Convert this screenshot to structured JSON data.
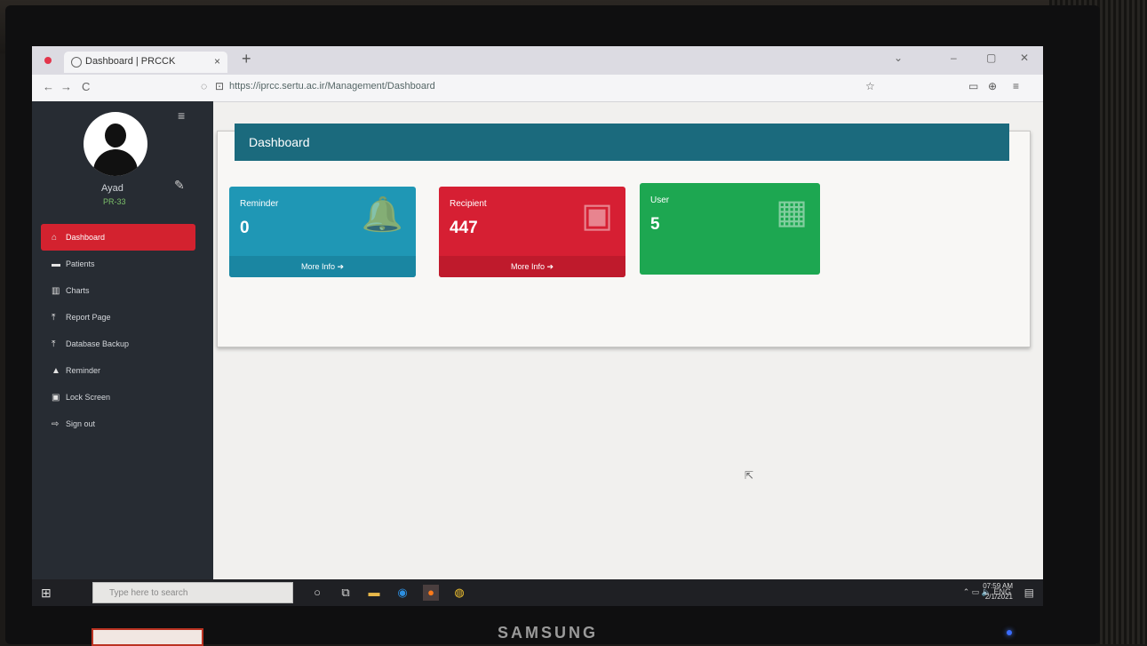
{
  "monitor": {
    "brand": "SAMSUNG"
  },
  "browser": {
    "tab_title": "Dashboard | PRCCK",
    "tab_close": "×",
    "new_tab": "+",
    "url": "https://iprcc.sertu.ac.ir/Management/Dashboard",
    "back": "←",
    "forward": "→",
    "reload": "C"
  },
  "sidebar": {
    "user_name": "Ayad",
    "user_status": "PR-33",
    "items": [
      {
        "label": "Dashboard",
        "icon": "home-icon",
        "glyph": "⌂",
        "active": true
      },
      {
        "label": "Patients",
        "icon": "patients-icon",
        "glyph": "▬",
        "active": false
      },
      {
        "label": "Charts",
        "icon": "chart-icon",
        "glyph": "▥",
        "active": false
      },
      {
        "label": "Report Page",
        "icon": "upload-icon",
        "glyph": "⤒",
        "active": false
      },
      {
        "label": "Database Backup",
        "icon": "upload-icon",
        "glyph": "⤒",
        "active": false
      },
      {
        "label": "Reminder",
        "icon": "bell-icon",
        "glyph": "▲",
        "active": false
      },
      {
        "label": "Lock Screen",
        "icon": "lock-icon",
        "glyph": "▣",
        "active": false
      },
      {
        "label": "Sign out",
        "icon": "signout-icon",
        "glyph": "⇨",
        "active": false
      }
    ]
  },
  "main": {
    "header_title": "Dashboard",
    "boxes": [
      {
        "label": "Reminder",
        "value": "0",
        "footer": "More Info",
        "icon": "bell-icon",
        "color": "#1f97b5"
      },
      {
        "label": "Recipient",
        "value": "447",
        "footer": "More Info",
        "icon": "users-icon",
        "color": "#d61f33"
      },
      {
        "label": "User",
        "value": "5",
        "icon": "users-icon",
        "color": "#1da751"
      }
    ]
  },
  "taskbar": {
    "search_placeholder": "Type here to search",
    "time": "07:59 AM",
    "date": "2/1/2021"
  },
  "colors": {
    "header": "#1b6a7d",
    "sidebar": "#272c33",
    "active_item": "#d3222f"
  }
}
